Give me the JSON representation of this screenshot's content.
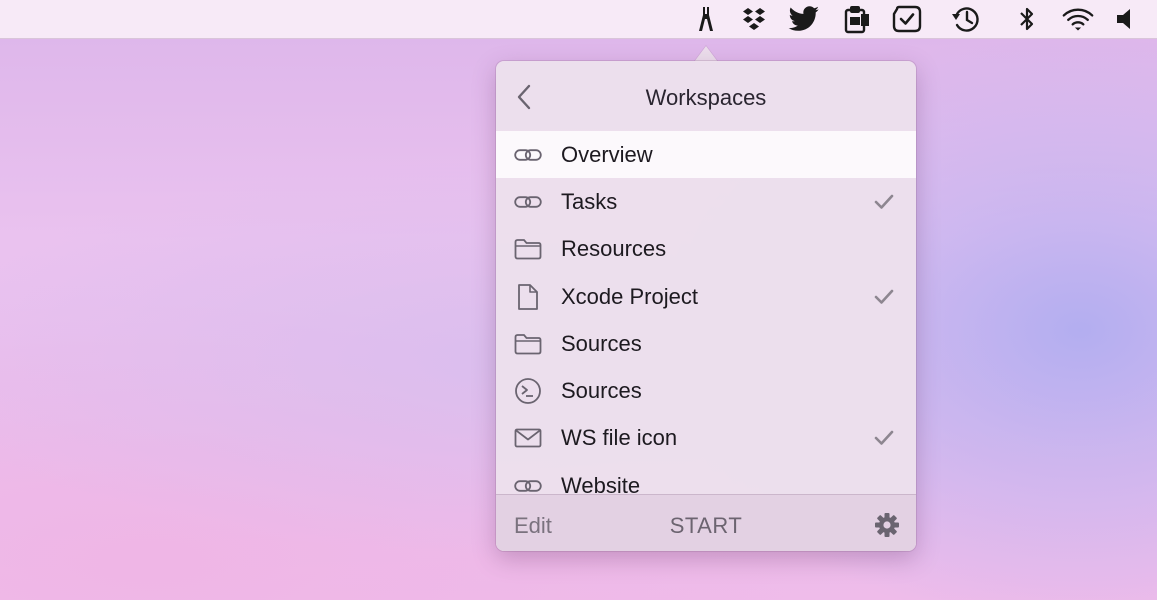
{
  "menubar": {
    "icons": [
      "tool-app-icon",
      "dropbox-icon",
      "twitter-icon",
      "clipboard-icon",
      "checkmark-badge-icon",
      "time-machine-icon",
      "bluetooth-icon",
      "wifi-icon",
      "volume-icon"
    ]
  },
  "popover": {
    "title": "Workspaces",
    "back_icon": "chevron-left-icon",
    "items": [
      {
        "icon": "link-icon",
        "label": "Overview",
        "checked": false,
        "selected": true
      },
      {
        "icon": "link-icon",
        "label": "Tasks",
        "checked": true,
        "selected": false
      },
      {
        "icon": "folder-icon",
        "label": "Resources",
        "checked": false,
        "selected": false
      },
      {
        "icon": "document-icon",
        "label": "Xcode Project",
        "checked": true,
        "selected": false
      },
      {
        "icon": "folder-icon",
        "label": "Sources",
        "checked": false,
        "selected": false
      },
      {
        "icon": "terminal-icon",
        "label": "Sources",
        "checked": false,
        "selected": false
      },
      {
        "icon": "mail-icon",
        "label": "WS file icon",
        "checked": true,
        "selected": false
      },
      {
        "icon": "link-icon",
        "label": "Website",
        "checked": false,
        "selected": false
      }
    ],
    "footer": {
      "edit_label": "Edit",
      "start_label": "START",
      "settings_icon": "gear-icon"
    }
  },
  "colors": {
    "icon_gray": "#6a6470",
    "check_gray": "#8d8690",
    "footer_text": "#7a727e"
  }
}
